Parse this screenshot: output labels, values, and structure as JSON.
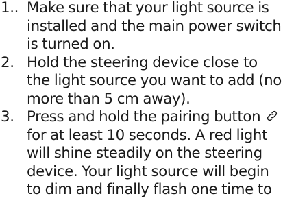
{
  "steps": [
    {
      "number": "1..",
      "lines": [
        "Make sure that your light source is",
        "installed and the main power switch",
        "is turned on."
      ]
    },
    {
      "number": "2.",
      "lines": [
        "Hold the steering device close to",
        "the light source you want to add (no",
        "more than 5 cm away)."
      ]
    },
    {
      "number": "3.",
      "lines": [
        "Press and hold the pairing button",
        "for at least 10 seconds. A red light",
        "will shine steadily on the steering",
        "device. Your light source will begin",
        "to dim and finally flash one time to"
      ],
      "inline_icon": "link-icon"
    }
  ]
}
